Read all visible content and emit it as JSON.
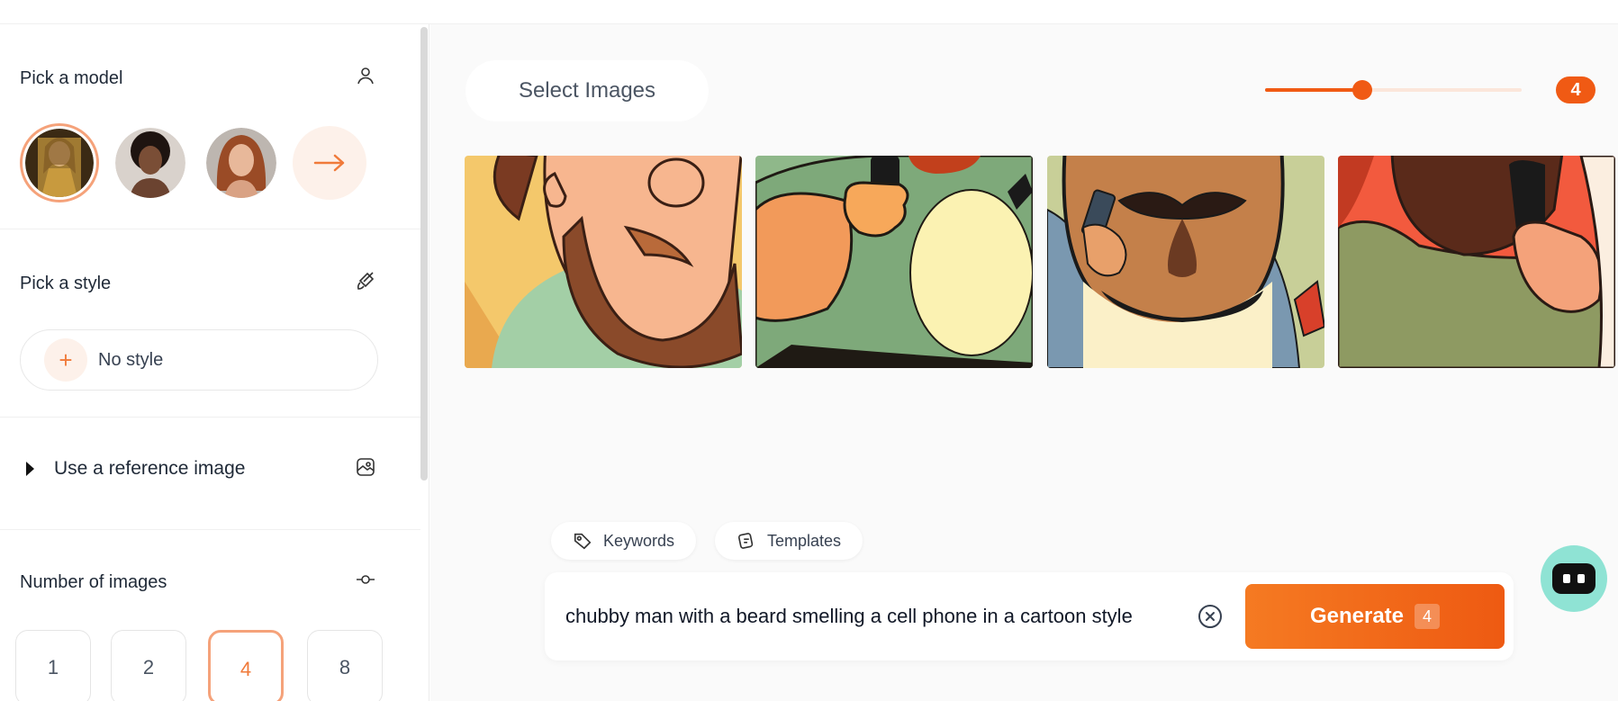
{
  "sidebar": {
    "model_section": {
      "title": "Pick a model",
      "icon": "person-icon"
    },
    "models": [
      {
        "name": "model-1",
        "selected": true,
        "color": "#8a6a35"
      },
      {
        "name": "model-2",
        "selected": false,
        "color": "#5a3d2e"
      },
      {
        "name": "model-3",
        "selected": false,
        "color": "#b06a4d"
      }
    ],
    "style_section": {
      "title": "Pick a style",
      "icon": "brush-icon",
      "current": "No style"
    },
    "reference_section": {
      "label": "Use a reference image",
      "icon": "image-icon"
    },
    "number_section": {
      "title": "Number of images",
      "icon": "slider-icon",
      "options": [
        "1",
        "2",
        "4",
        "8"
      ],
      "selected": "4"
    }
  },
  "main": {
    "select_images_label": "Select Images",
    "image_count": {
      "value": "4",
      "fraction": 0.38
    },
    "tabs": {
      "keywords": "Keywords",
      "templates": "Templates"
    },
    "prompt": "chubby man with a beard smelling a cell phone in a cartoon style",
    "generate": {
      "label": "Generate",
      "count": "4"
    }
  },
  "colors": {
    "accent": "#f05a14",
    "accent_light": "#fdf1ea",
    "bot": "#8fe3d4"
  }
}
